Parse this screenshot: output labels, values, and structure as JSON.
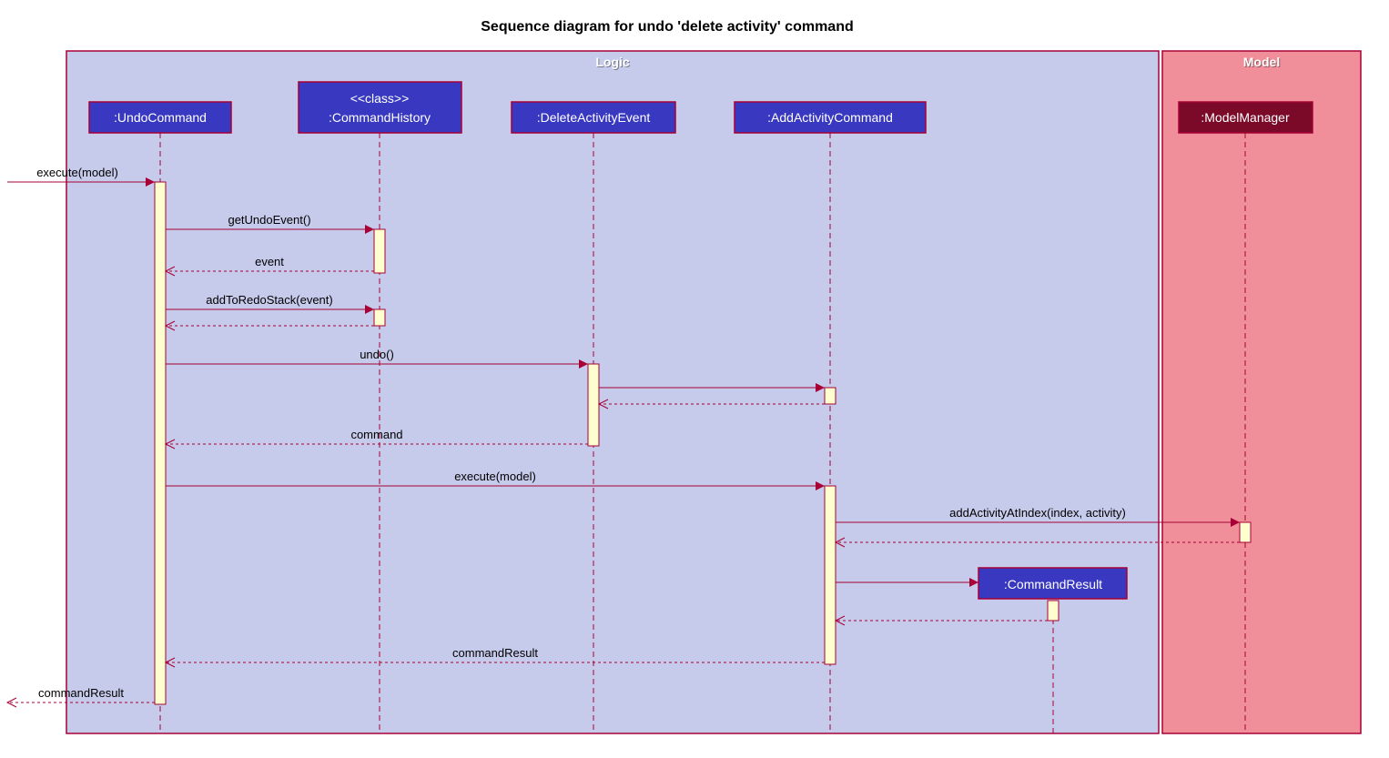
{
  "title": "Sequence diagram for undo 'delete activity' command",
  "frames": {
    "logic": "Logic",
    "model": "Model"
  },
  "lifelines": {
    "undoCommand": ":UndoCommand",
    "commandHistoryStereo": "<<class>>",
    "commandHistory": ":CommandHistory",
    "deleteActivityEvent": ":DeleteActivityEvent",
    "addActivityCommand": ":AddActivityCommand",
    "commandResult": ":CommandResult",
    "modelManager": ":ModelManager"
  },
  "messages": {
    "execute1": "execute(model)",
    "getUndoEvent": "getUndoEvent()",
    "event": "event",
    "addToRedoStack": "addToRedoStack(event)",
    "undo": "undo()",
    "command": "command",
    "execute2": "execute(model)",
    "addActivityAtIndex": "addActivityAtIndex(index, activity)",
    "commandResult": "commandResult",
    "commandResultOut": "commandResult"
  }
}
